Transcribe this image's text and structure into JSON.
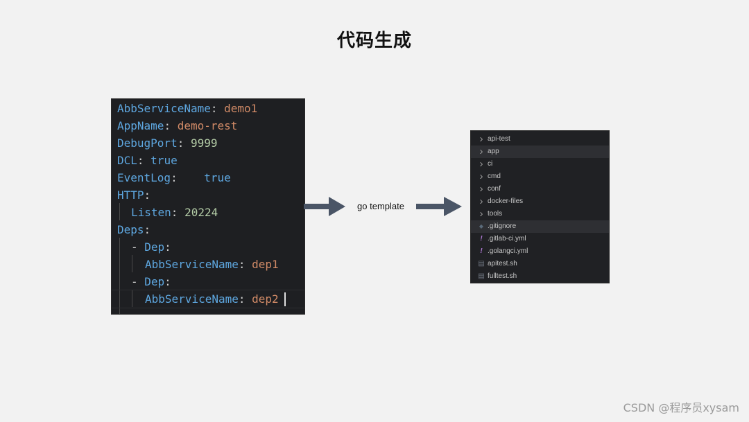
{
  "title": "代码生成",
  "code": {
    "lines": [
      {
        "key": "AbbServiceName",
        "sep": ": ",
        "value": "demo1"
      },
      {
        "key": "AppName",
        "sep": ": ",
        "value": "demo-rest"
      },
      {
        "key": "DebugPort",
        "sep": ": ",
        "value": "9999"
      },
      {
        "key": "DCL",
        "sep": ": ",
        "value": "true"
      },
      {
        "key": "EventLog",
        "sep": ":    ",
        "value": "true"
      },
      {
        "key": "HTTP",
        "sep": ":",
        "value": ""
      },
      {
        "key": "Listen",
        "sep": ": ",
        "value": "20224"
      },
      {
        "key": "Deps",
        "sep": ":",
        "value": ""
      },
      {
        "dash": "- ",
        "key": "Dep",
        "sep": ":",
        "value": ""
      },
      {
        "key": "AbbServiceName",
        "sep": ": ",
        "value": "dep1"
      },
      {
        "dash": "- ",
        "key": "Dep",
        "sep": ":",
        "value": ""
      },
      {
        "key": "AbbServiceName",
        "sep": ": ",
        "value": "dep2"
      }
    ]
  },
  "arrow_label": "go template",
  "file_tree": {
    "items": [
      {
        "icon": "chevron-right",
        "label": "api-test"
      },
      {
        "icon": "chevron-right",
        "label": "app",
        "selected": true
      },
      {
        "icon": "chevron-right",
        "label": "ci"
      },
      {
        "icon": "chevron-right",
        "label": "cmd"
      },
      {
        "icon": "chevron-right",
        "label": "conf"
      },
      {
        "icon": "chevron-right",
        "label": "docker-files"
      },
      {
        "icon": "chevron-right",
        "label": "tools"
      },
      {
        "icon": "git-file",
        "label": ".gitignore",
        "selected": true
      },
      {
        "icon": "yaml-file",
        "label": ".gitlab-ci.yml"
      },
      {
        "icon": "yaml-file",
        "label": ".golangci.yml"
      },
      {
        "icon": "shell-file",
        "label": "apitest.sh"
      },
      {
        "icon": "shell-file",
        "label": "fulltest.sh"
      }
    ]
  },
  "watermark": "CSDN @程序员xysam",
  "colors": {
    "key": "#5ea7e0",
    "string": "#d28b67",
    "number": "#b5cea8",
    "yaml_icon": "#b07ad6",
    "arrow": "#4a5566"
  }
}
